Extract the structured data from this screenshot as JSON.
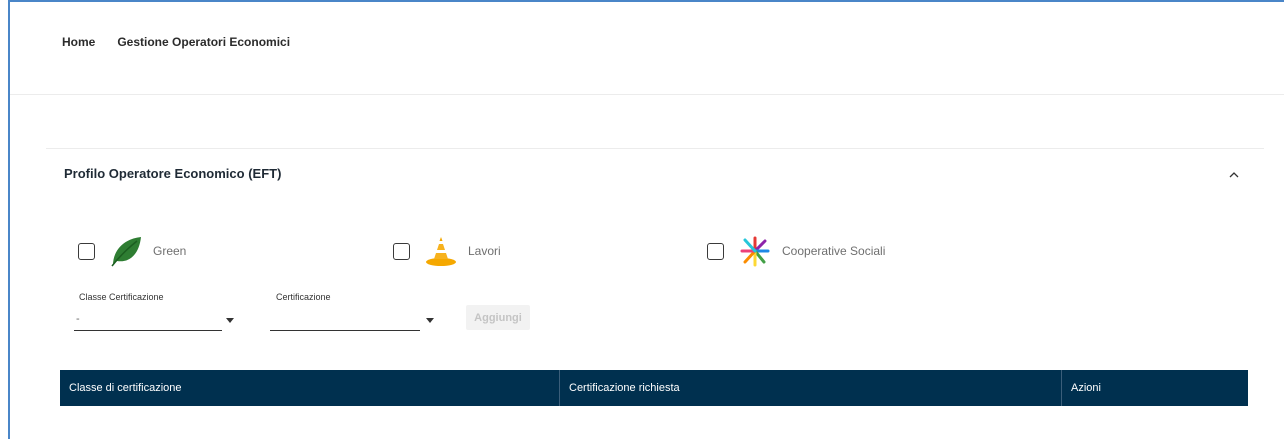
{
  "breadcrumb": {
    "home": "Home",
    "current": "Gestione Operatori Economici"
  },
  "section": {
    "title": "Profilo Operatore Economico (EFT)",
    "collapse_icon": "chevron-up-icon"
  },
  "options": [
    {
      "label": "Green",
      "icon": "leaf-icon",
      "checked": false,
      "color": "#2e7d32"
    },
    {
      "label": "Lavori",
      "icon": "cone-icon",
      "checked": false,
      "color": "#f5a800"
    },
    {
      "label": "Cooperative Sociali",
      "icon": "hands-icon",
      "checked": false
    }
  ],
  "filters": {
    "classe_label": "Classe Certificazione",
    "classe_value": "-",
    "cert_label": "Certificazione",
    "cert_value": "",
    "add_button": "Aggiungi"
  },
  "table": {
    "columns": [
      "Classe di certificazione",
      "Certificazione richiesta",
      "Azioni"
    ],
    "header_color": "#00304f"
  }
}
